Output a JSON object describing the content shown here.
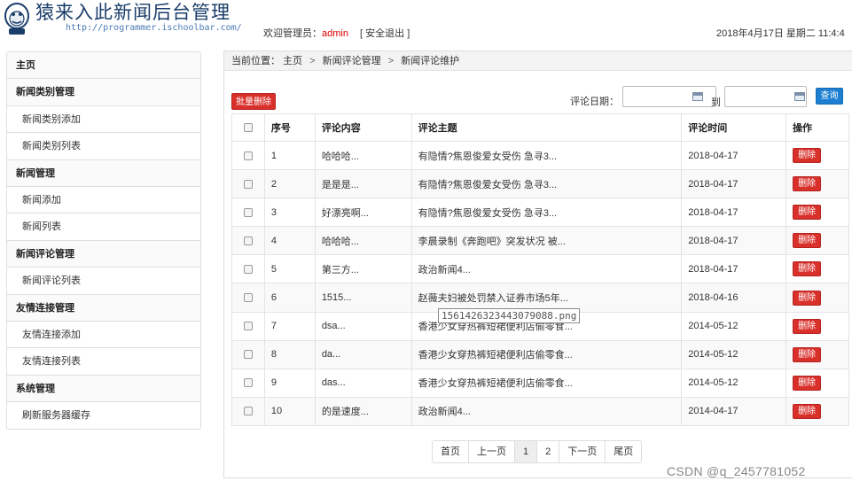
{
  "header": {
    "title": "猿来入此新闻后台管理",
    "url": "http://programmer.ischoolbar.com/",
    "welcome_prefix": "欢迎管理员：",
    "username": "admin",
    "logout": "[ 安全退出 ]",
    "date": "2018年4月17日 星期二 11:4:4"
  },
  "sidebar": {
    "items": [
      {
        "label": "主页",
        "type": "group"
      },
      {
        "label": "新闻类别管理",
        "type": "group"
      },
      {
        "label": "新闻类别添加",
        "type": "sub"
      },
      {
        "label": "新闻类别列表",
        "type": "sub"
      },
      {
        "label": "新闻管理",
        "type": "group"
      },
      {
        "label": "新闻添加",
        "type": "sub"
      },
      {
        "label": "新闻列表",
        "type": "sub"
      },
      {
        "label": "新闻评论管理",
        "type": "group"
      },
      {
        "label": "新闻评论列表",
        "type": "sub"
      },
      {
        "label": "友情连接管理",
        "type": "group"
      },
      {
        "label": "友情连接添加",
        "type": "sub"
      },
      {
        "label": "友情连接列表",
        "type": "sub"
      },
      {
        "label": "系统管理",
        "type": "group"
      },
      {
        "label": "刷新服务器缓存",
        "type": "sub"
      }
    ]
  },
  "breadcrumb": {
    "prefix": "当前位置：",
    "items": [
      "主页",
      "新闻评论管理",
      "新闻评论维护"
    ],
    "separator": ">"
  },
  "toolbar": {
    "batch_delete": "批量删除",
    "date_label": "评论日期：",
    "from_value": "",
    "to_label": "到",
    "to_value": "",
    "search": "查询"
  },
  "table": {
    "headers": [
      "序号",
      "评论内容",
      "评论主题",
      "评论时间",
      "操作"
    ],
    "delete_label": "删除",
    "rows": [
      {
        "no": "1",
        "content": "哈哈哈...",
        "topic": "有隐情?焦恩俊爱女受伤 急寻3...",
        "time": "2018-04-17"
      },
      {
        "no": "2",
        "content": "是是是...",
        "topic": "有隐情?焦恩俊爱女受伤 急寻3...",
        "time": "2018-04-17"
      },
      {
        "no": "3",
        "content": "好漂亮啊...",
        "topic": "有隐情?焦恩俊爱女受伤 急寻3...",
        "time": "2018-04-17"
      },
      {
        "no": "4",
        "content": "哈哈哈...",
        "topic": "李晨录制《奔跑吧》突发状况 被...",
        "time": "2018-04-17"
      },
      {
        "no": "5",
        "content": "第三方...",
        "topic": "政治新闻4...",
        "time": "2018-04-17"
      },
      {
        "no": "6",
        "content": "1515...",
        "topic": "赵薇夫妇被处罚禁入证券市场5年...",
        "time": "2018-04-16"
      },
      {
        "no": "7",
        "content": "dsa...",
        "topic": "香港少女穿热裤短裙便利店偷零食...",
        "time": "2014-05-12"
      },
      {
        "no": "8",
        "content": "da...",
        "topic": "香港少女穿热裤短裙便利店偷零食...",
        "time": "2014-05-12"
      },
      {
        "no": "9",
        "content": "das...",
        "topic": "香港少女穿热裤短裙便利店偷零食...",
        "time": "2014-05-12"
      },
      {
        "no": "10",
        "content": "的是速度...",
        "topic": "政治新闻4...",
        "time": "2014-04-17"
      }
    ]
  },
  "tooltip": "1561426323443079088.png",
  "pagination": {
    "first": "首页",
    "prev": "上一页",
    "pages": [
      "1",
      "2"
    ],
    "current": "1",
    "next": "下一页",
    "last": "尾页"
  },
  "watermark": "CSDN @q_2457781052"
}
